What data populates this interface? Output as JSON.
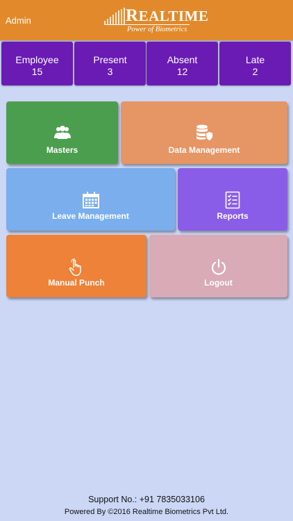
{
  "header": {
    "user": "Admin",
    "logo_name_first": "R",
    "logo_name_rest": "EALTIME",
    "logo_tagline": "Power of Biometrics"
  },
  "stats": [
    {
      "label": "Employee",
      "value": "15"
    },
    {
      "label": "Present",
      "value": "3"
    },
    {
      "label": "Absent",
      "value": "12"
    },
    {
      "label": "Late",
      "value": "2"
    }
  ],
  "menu": {
    "masters": "Masters",
    "data_management": "Data Management",
    "leave_management": "Leave Management",
    "reports": "Reports",
    "manual_punch": "Manual Punch",
    "logout": "Logout"
  },
  "footer": {
    "support": "Support No.: +91 7835033106",
    "powered": "Powered By ©2016 Realtime Biometrics Pvt Ltd."
  },
  "colors": {
    "header": "#e28a2b",
    "stat_bg": "#6a1bb3",
    "masters": "#4b9e4e",
    "data_management": "#e69565",
    "leave_management": "#7aaeed",
    "reports": "#8a5de8",
    "manual_punch": "#ed8238",
    "logout": "#d8abb6",
    "background": "#cbd7f5"
  },
  "icons": {
    "masters": "users-icon",
    "data_management": "database-shield-icon",
    "leave_management": "calendar-icon",
    "reports": "checklist-icon",
    "manual_punch": "hand-pointer-icon",
    "logout": "power-icon"
  }
}
